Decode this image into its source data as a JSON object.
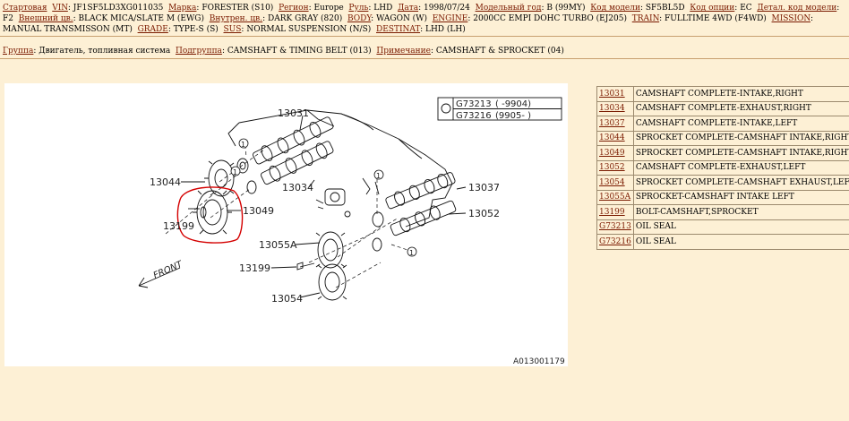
{
  "header": {
    "fields": [
      {
        "label": "Стартовая",
        "value": ""
      },
      {
        "label": "VIN",
        "value": "JF1SF5LD3XG011035"
      },
      {
        "label": "Марка",
        "value": "FORESTER (S10)"
      },
      {
        "label": "Регион",
        "value": "Europe"
      },
      {
        "label": "Руль",
        "value": "LHD"
      },
      {
        "label": "Дата",
        "value": "1998/07/24"
      },
      {
        "label": "Модельный год",
        "value": "B (99MY)"
      },
      {
        "label": "Код модели",
        "value": "SF5BL5D"
      },
      {
        "label": "Код опции",
        "value": "EC"
      },
      {
        "label": "Детал. код модели",
        "value": "F2"
      },
      {
        "label": "Внешний цв.",
        "value": "BLACK MICA/SLATE M (EWG)"
      },
      {
        "label": "Внутрен. цв.",
        "value": "DARK GRAY (820)"
      },
      {
        "label": "BODY",
        "value": "WAGON (W)"
      },
      {
        "label": "ENGINE",
        "value": "2000CC EMPI DOHC TURBO (EJ205)"
      },
      {
        "label": "TRAIN",
        "value": "FULLTIME 4WD (F4WD)"
      },
      {
        "label": "MISSION",
        "value": "MANUAL TRANSMISSON (MT)"
      },
      {
        "label": "GRADE",
        "value": "TYPE-S (S)"
      },
      {
        "label": "SUS",
        "value": "NORMAL SUSPENSION (N/S)"
      },
      {
        "label": "DESTINAT",
        "value": "LHD (LH)"
      }
    ]
  },
  "breadcrumb": {
    "group_label": "Группа",
    "group_value": "Двигатель, топливная система",
    "subgroup_label": "Подгруппа",
    "subgroup_value": "CAMSHAFT & TIMING BELT (013)",
    "note_label": "Примечание",
    "note_value": "CAMSHAFT & SPROCKET (04)"
  },
  "diagram": {
    "ref_table": [
      {
        "code": "G73213",
        "range": "(    -9904)"
      },
      {
        "code": "G73216",
        "range": "(9905-    )"
      }
    ],
    "callouts": [
      "13031",
      "13044",
      "13199",
      "13049",
      "13034",
      "13037",
      "13052",
      "13055A",
      "13199",
      "13054",
      "1",
      "1",
      "1",
      "1"
    ],
    "front_label": "FRONT",
    "figure_id": "A013001179"
  },
  "parts": [
    {
      "code": "13031",
      "desc": "CAMSHAFT COMPLETE-INTAKE,RIGHT"
    },
    {
      "code": "13034",
      "desc": "CAMSHAFT COMPLETE-EXHAUST,RIGHT"
    },
    {
      "code": "13037",
      "desc": "CAMSHAFT COMPLETE-INTAKE,LEFT"
    },
    {
      "code": "13044",
      "desc": "SPROCKET COMPLETE-CAMSHAFT INTAKE,RIGHT"
    },
    {
      "code": "13049",
      "desc": "SPROCKET COMPLETE-CAMSHAFT INTAKE,RIGHT"
    },
    {
      "code": "13052",
      "desc": "CAMSHAFT COMPLETE-EXHAUST,LEFT"
    },
    {
      "code": "13054",
      "desc": "SPROCKET COMPLETE-CAMSHAFT EXHAUST,LEFT"
    },
    {
      "code": "13055A",
      "desc": "SPROCKET-CAMSHAFT INTAKE LEFT"
    },
    {
      "code": "13199",
      "desc": "BOLT-CAMSHAFT,SPROCKET"
    },
    {
      "code": "G73213",
      "desc": "OIL SEAL"
    },
    {
      "code": "G73216",
      "desc": "OIL SEAL"
    }
  ]
}
